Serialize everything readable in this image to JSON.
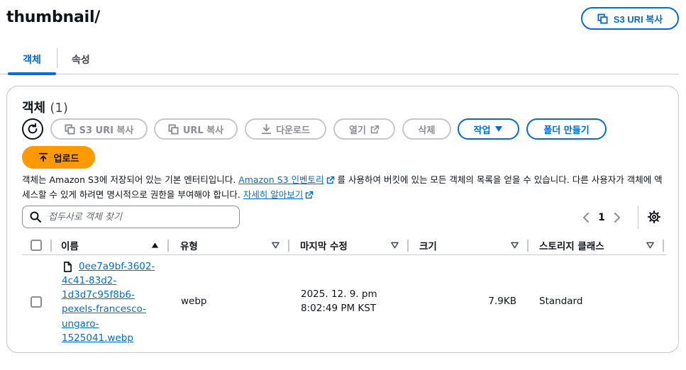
{
  "header": {
    "title": "thumbnail/",
    "copy_uri_label": "S3 URI 복사"
  },
  "tabs": [
    {
      "label": "객체",
      "active": true
    },
    {
      "label": "속성",
      "active": false
    }
  ],
  "objects_panel": {
    "title": "객체",
    "count": "(1)",
    "toolbar": {
      "copy_s3_uri": "S3 URI 복사",
      "copy_url": "URL 복사",
      "download": "다운로드",
      "open": "열기",
      "delete": "삭제",
      "actions": "작업",
      "create_folder": "폴더 만들기",
      "upload": "업로드"
    },
    "description": {
      "part1": "객체는 Amazon S3에 저장되어 있는 기본 엔터티입니다. ",
      "link1": "Amazon S3 인벤토리",
      "part2": " 를 사용하여 버킷에 있는 모든 객체의 목록을 얻을 수 있습니다. 다른 사용자가 객체에 액세스할 수 있게 하려면 명시적으로 권한을 부여해야 합니다. ",
      "link2": "자세히 알아보기"
    },
    "search": {
      "placeholder": "접두사로 객체 찾기",
      "value": ""
    },
    "pagination": {
      "current_page": "1"
    },
    "table": {
      "columns": [
        "이름",
        "유형",
        "마지막 수정",
        "크기",
        "스토리지 클래스"
      ],
      "rows": [
        {
          "name_lines": [
            "0ee7a9bf-3602-",
            "4c41-83d2-",
            "1d3d7c95f8b6-",
            "pexels-francesco-",
            "ungaro-",
            "1525041.webp"
          ],
          "type": "webp",
          "modified_line1": "2025. 12. 9. pm",
          "modified_line2": "8:02:49 PM KST",
          "size": "7.9KB",
          "storage_class": "Standard"
        }
      ]
    }
  },
  "colors": {
    "accent": "#006ce0",
    "upload": "#ff9900",
    "border": "#c6c6cd",
    "disabled": "#8c8c94"
  }
}
